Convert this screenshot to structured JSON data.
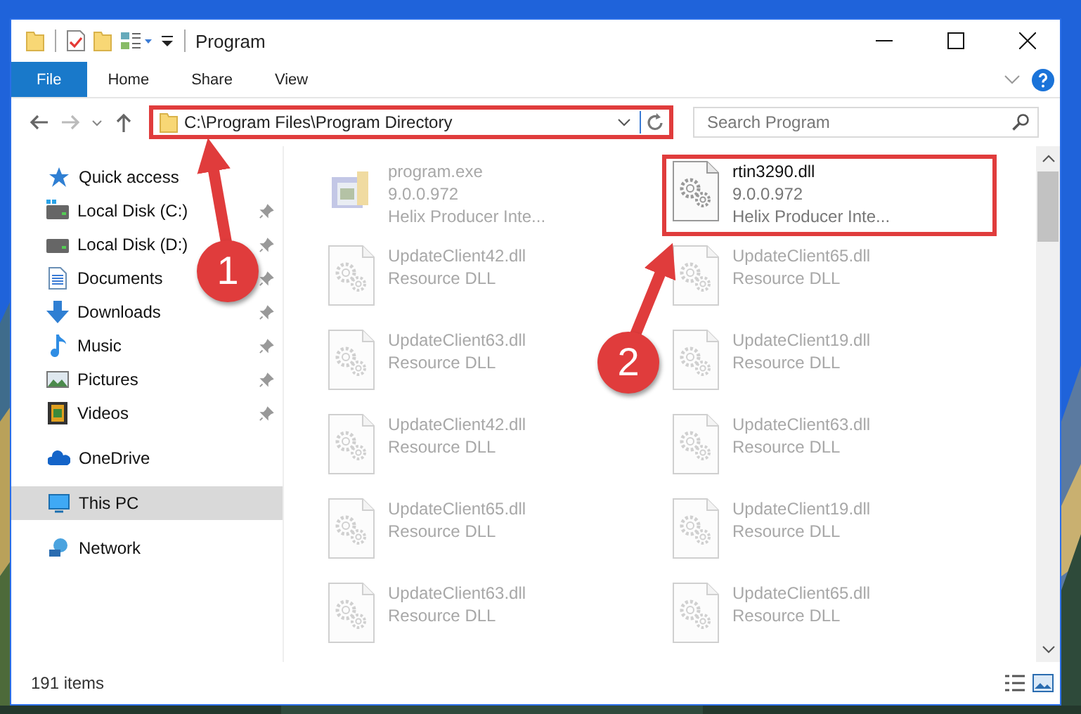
{
  "window": {
    "title": "Program"
  },
  "ribbon": {
    "tabs": [
      {
        "label": "File",
        "selected": true
      },
      {
        "label": "Home",
        "selected": false
      },
      {
        "label": "Share",
        "selected": false
      },
      {
        "label": "View",
        "selected": false
      }
    ]
  },
  "address": {
    "value": "C:\\Program Files\\Program Directory",
    "highlighted": true
  },
  "search": {
    "placeholder": "Search Program"
  },
  "sidebar": {
    "items": [
      {
        "label": "Quick access",
        "selected": false,
        "children": [
          {
            "label": "Local Disk (C:)",
            "pinned": true,
            "selected": false
          },
          {
            "label": "Local Disk (D:)",
            "pinned": true,
            "selected": false
          },
          {
            "label": "Documents",
            "pinned": true,
            "selected": false
          },
          {
            "label": "Downloads",
            "pinned": true,
            "selected": false
          },
          {
            "label": "Music",
            "pinned": true,
            "selected": false
          },
          {
            "label": "Pictures",
            "pinned": true,
            "selected": false
          },
          {
            "label": "Videos",
            "pinned": true,
            "selected": false
          }
        ]
      },
      {
        "label": "OneDrive",
        "selected": false
      },
      {
        "label": "This PC",
        "selected": true
      },
      {
        "label": "Network",
        "selected": false
      }
    ]
  },
  "files": [
    {
      "kind": "exe",
      "name": "program.exe",
      "lines": [
        "9.0.0.972",
        "Helix Producer Inte..."
      ],
      "faded": true,
      "highlighted": false
    },
    {
      "kind": "dll",
      "name": "rtin3290.dll",
      "lines": [
        "9.0.0.972",
        "Helix Producer Inte..."
      ],
      "faded": false,
      "highlighted": true
    },
    {
      "kind": "dll",
      "name": "UpdateClient42.dll",
      "lines": [
        "Resource DLL"
      ],
      "faded": true,
      "highlighted": false
    },
    {
      "kind": "dll",
      "name": "UpdateClient65.dll",
      "lines": [
        "Resource DLL"
      ],
      "faded": true,
      "highlighted": false
    },
    {
      "kind": "dll",
      "name": "UpdateClient63.dll",
      "lines": [
        "Resource DLL"
      ],
      "faded": true,
      "highlighted": false
    },
    {
      "kind": "dll",
      "name": "UpdateClient19.dll",
      "lines": [
        "Resource DLL"
      ],
      "faded": true,
      "highlighted": false
    },
    {
      "kind": "dll",
      "name": "UpdateClient42.dll",
      "lines": [
        "Resource DLL"
      ],
      "faded": true,
      "highlighted": false
    },
    {
      "kind": "dll",
      "name": "UpdateClient63.dll",
      "lines": [
        "Resource DLL"
      ],
      "faded": true,
      "highlighted": false
    },
    {
      "kind": "dll",
      "name": "UpdateClient65.dll",
      "lines": [
        "Resource DLL"
      ],
      "faded": true,
      "highlighted": false
    },
    {
      "kind": "dll",
      "name": "UpdateClient19.dll",
      "lines": [
        "Resource DLL"
      ],
      "faded": true,
      "highlighted": false
    },
    {
      "kind": "dll",
      "name": "UpdateClient63.dll",
      "lines": [
        "Resource DLL"
      ],
      "faded": true,
      "highlighted": false
    },
    {
      "kind": "dll",
      "name": "UpdateClient65.dll",
      "lines": [
        "Resource DLL"
      ],
      "faded": true,
      "highlighted": false
    }
  ],
  "status_bar": {
    "count": "191 items"
  },
  "annotations": [
    {
      "label": "1"
    },
    {
      "label": "2"
    }
  ]
}
